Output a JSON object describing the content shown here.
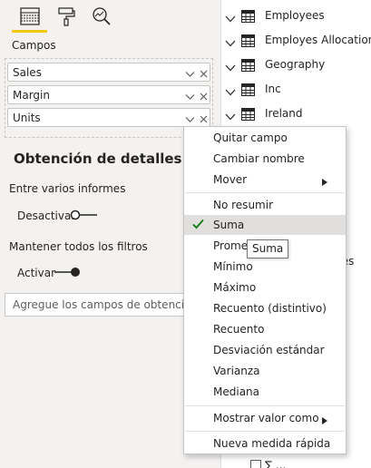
{
  "visualizations_pane": {
    "tabs": [
      {
        "icon": "fields-icon",
        "active": true
      },
      {
        "icon": "format-paint-roller-icon",
        "active": false
      },
      {
        "icon": "analytics-magnifier-icon",
        "active": false
      }
    ],
    "fields_label": "Campos",
    "field_wells": [
      {
        "name": "Sales"
      },
      {
        "name": "Margin"
      },
      {
        "name": "Units"
      }
    ],
    "drillthrough": {
      "title": "Obtención de detalles",
      "cross_report_label": "Entre varios informes",
      "cross_report_toggle": {
        "state_label": "Desactivar",
        "on": false
      },
      "keep_filters_label": "Mantener todos los filtros",
      "keep_filters_toggle": {
        "state_label": "Activar",
        "on": true
      },
      "drop_placeholder": "Agregue los campos de obtención de detalles aquí"
    }
  },
  "fields_list": {
    "items": [
      {
        "name": "Employees"
      },
      {
        "name": "Employes Allocations"
      },
      {
        "name": "Geography"
      },
      {
        "name": "Inc"
      },
      {
        "name": "Ireland"
      }
    ],
    "peek_text": "ales",
    "bottom_peek_text": "∑ ..."
  },
  "context_menu": {
    "groups": [
      [
        {
          "label": "Quitar campo"
        },
        {
          "label": "Cambiar nombre"
        },
        {
          "label": "Mover",
          "submenu": true
        }
      ],
      [
        {
          "label": "No resumir"
        },
        {
          "label": "Suma",
          "checked": true,
          "highlighted": true
        },
        {
          "label": "Promedio"
        },
        {
          "label": "Mínimo"
        },
        {
          "label": "Máximo"
        },
        {
          "label": "Recuento (distintivo)"
        },
        {
          "label": "Recuento"
        },
        {
          "label": "Desviación estándar"
        },
        {
          "label": "Varianza"
        },
        {
          "label": "Mediana"
        }
      ],
      [
        {
          "label": "Mostrar valor como",
          "submenu": true
        }
      ],
      [
        {
          "label": "Nueva medida rápida"
        }
      ]
    ]
  },
  "tooltip": {
    "text": "Suma"
  },
  "colors": {
    "accent_yellow": "#f2c811",
    "checkmark_green": "#107c10",
    "pane_background": "#f3f2f1",
    "selected_item": "#e1dfdd"
  }
}
